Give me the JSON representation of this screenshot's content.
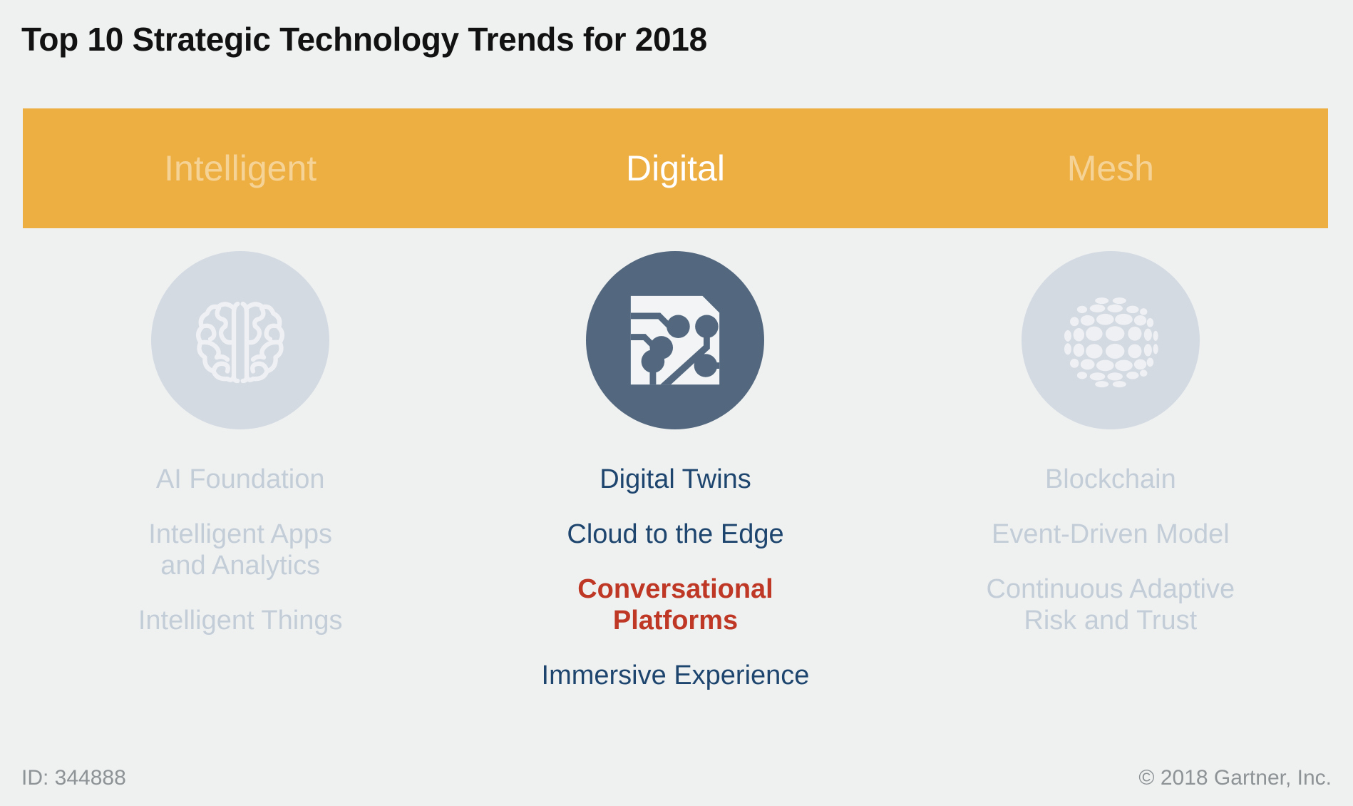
{
  "page": {
    "title": "Top 10 Strategic Technology Trends for 2018",
    "background_color": "#eff1f1"
  },
  "banner": {
    "background_color": "#eeaf42",
    "categories": [
      {
        "label": "Intelligent",
        "state": "dim"
      },
      {
        "label": "Digital",
        "state": "active"
      },
      {
        "label": "Mesh",
        "state": "dim"
      }
    ]
  },
  "columns": [
    {
      "category": "Intelligent",
      "state": "dim",
      "icon": "brain-icon",
      "icon_circle_color": "#d4dae2",
      "text_color": "#c3cdd8",
      "trends": [
        {
          "label": "AI Foundation",
          "style": "dim"
        },
        {
          "label": "Intelligent Apps\nand Analytics",
          "style": "dim"
        },
        {
          "label": "Intelligent Things",
          "style": "dim"
        }
      ]
    },
    {
      "category": "Digital",
      "state": "active",
      "icon": "circuit-board-icon",
      "icon_circle_color": "#53687f",
      "text_color": "#1d456e",
      "highlight_color": "#bf3725",
      "trends": [
        {
          "label": "Digital Twins",
          "style": "normal"
        },
        {
          "label": "Cloud to the Edge",
          "style": "normal"
        },
        {
          "label": "Conversational\nPlatforms",
          "style": "highlight"
        },
        {
          "label": "Immersive Experience",
          "style": "normal"
        }
      ]
    },
    {
      "category": "Mesh",
      "state": "dim",
      "icon": "globe-mesh-icon",
      "icon_circle_color": "#d4dae2",
      "text_color": "#c3cdd8",
      "trends": [
        {
          "label": "Blockchain",
          "style": "dim"
        },
        {
          "label": "Event-Driven Model",
          "style": "dim"
        },
        {
          "label": "Continuous Adaptive\nRisk and Trust",
          "style": "dim"
        }
      ]
    }
  ],
  "footer": {
    "id_label": "ID: 344888",
    "copyright": "© 2018 Gartner, Inc."
  }
}
